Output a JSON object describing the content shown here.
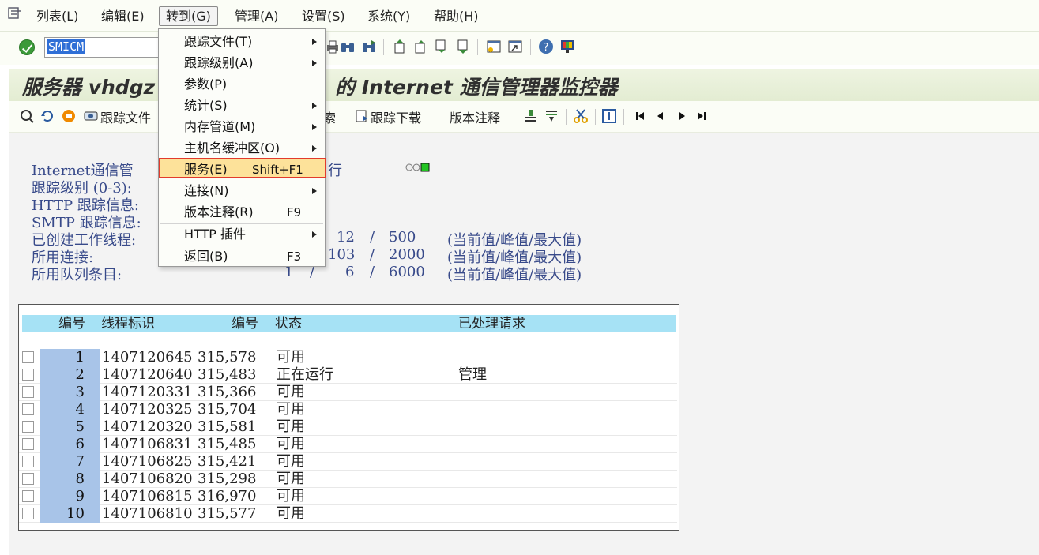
{
  "menubar": {
    "items": [
      "列表(L)",
      "编辑(E)",
      "转到(G)",
      "管理(A)",
      "设置(S)",
      "系统(Y)",
      "帮助(H)"
    ]
  },
  "toolbar": {
    "command_value": "SMICM"
  },
  "title": "服务器 vhdgzo                     的 Internet 通信管理器监控器",
  "title_left": "服务器 vhdgz",
  "title_right": "的 Internet 通信管理器监控器",
  "app_toolbar": {
    "trace_file": "跟踪文件",
    "search": "索",
    "trace_download": "跟踪下载",
    "release_notes": "版本注释"
  },
  "dropdown": {
    "items": [
      {
        "label": "跟踪文件(T)",
        "submenu": true
      },
      {
        "label": "跟踪级别(A)",
        "submenu": true
      },
      {
        "label": "参数(P)",
        "submenu": false
      },
      {
        "label": "统计(S)",
        "submenu": true
      },
      {
        "label": "内存管道(M)",
        "submenu": true
      },
      {
        "label": "主机名缓冲区(O)",
        "submenu": true
      },
      {
        "label": "服务(E)",
        "shortcut": "Shift+F1",
        "highlighted": true
      },
      {
        "label": "连接(N)",
        "submenu": true
      },
      {
        "label": "版本注释(R)",
        "shortcut": "F9"
      },
      {
        "label": "HTTP 插件",
        "submenu": true
      },
      {
        "label": "返回(B)",
        "shortcut": "F3"
      }
    ]
  },
  "info": {
    "lines": [
      "Internet通信管",
      "跟踪级别 (0-3):",
      "HTTP 跟踪信息:",
      "SMTP 跟踪信息:",
      "已创建工作线程:",
      "所用连接:",
      "所用队列条目:"
    ],
    "status_fragment": "行",
    "stats": [
      {
        "current": "",
        "peak": "12",
        "max": "500",
        "note": "(当前值/峰值/最大值)"
      },
      {
        "current": "",
        "peak": "103",
        "max": "2000",
        "note": "(当前值/峰值/最大值)"
      },
      {
        "current": "1",
        "peak": "6",
        "max": "6000",
        "note": "(当前值/峰值/最大值)"
      }
    ],
    "slash": "/"
  },
  "table": {
    "headers": [
      "编号",
      "线程标识",
      "编号",
      "状态",
      "已处理请求"
    ],
    "rows": [
      {
        "no": "1",
        "thread": "1407120645",
        "num": "315,578",
        "status": "可用",
        "req": ""
      },
      {
        "no": "2",
        "thread": "1407120640",
        "num": "315,483",
        "status": "正在运行",
        "req": "管理"
      },
      {
        "no": "3",
        "thread": "1407120331",
        "num": "315,366",
        "status": "可用",
        "req": ""
      },
      {
        "no": "4",
        "thread": "1407120325",
        "num": "315,704",
        "status": "可用",
        "req": ""
      },
      {
        "no": "5",
        "thread": "1407120320",
        "num": "315,581",
        "status": "可用",
        "req": ""
      },
      {
        "no": "6",
        "thread": "1407106831",
        "num": "315,485",
        "status": "可用",
        "req": ""
      },
      {
        "no": "7",
        "thread": "1407106825",
        "num": "315,421",
        "status": "可用",
        "req": ""
      },
      {
        "no": "8",
        "thread": "1407106820",
        "num": "315,298",
        "status": "可用",
        "req": ""
      },
      {
        "no": "9",
        "thread": "1407106815",
        "num": "316,970",
        "status": "可用",
        "req": ""
      },
      {
        "no": "10",
        "thread": "1407106810",
        "num": "315,577",
        "status": "可用",
        "req": ""
      }
    ]
  },
  "colors": {
    "highlight_border": "#e23b2c",
    "highlight_fill": "#fde29a",
    "table_header": "#a6e2f5",
    "row_number": "#a8c4e8",
    "info_text": "#384a8a"
  },
  "icons": [
    "menu-icon",
    "ok-check-icon",
    "print-icon",
    "find-icon",
    "find-next-icon",
    "first-page-icon",
    "prev-page-icon",
    "next-page-icon",
    "last-page-icon",
    "new-session-icon",
    "shortcut-icon",
    "help-icon",
    "customize-layout-icon"
  ]
}
